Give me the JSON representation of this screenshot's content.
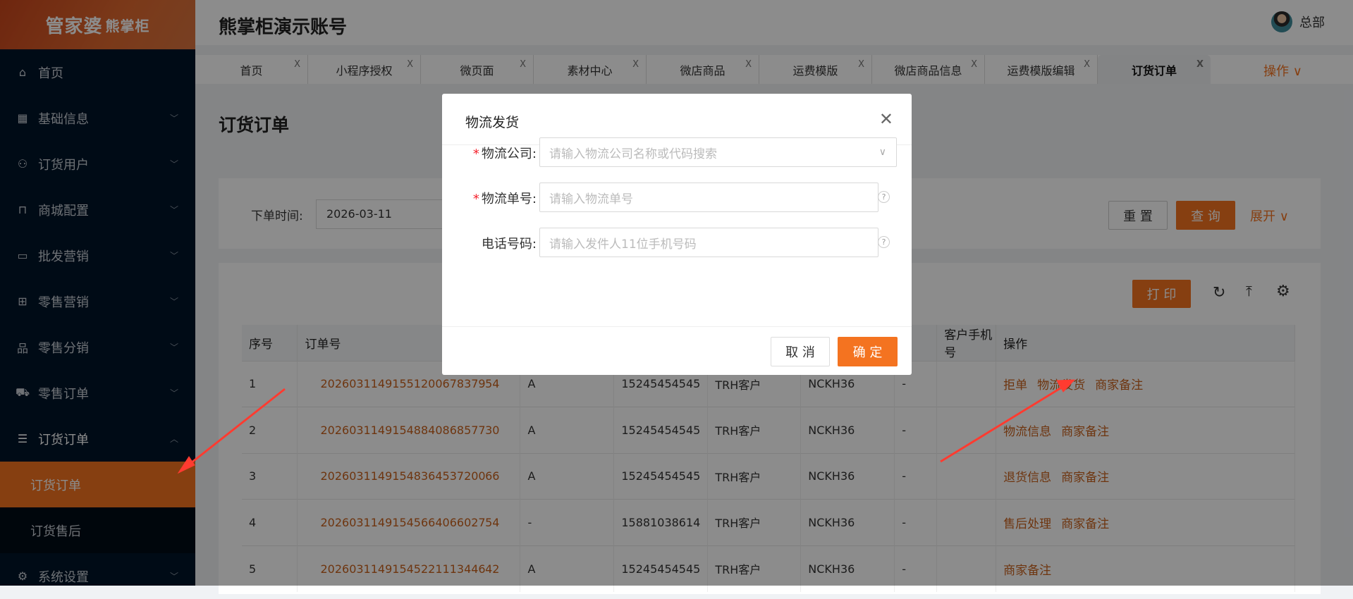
{
  "sidebar": {
    "logo": "管家婆",
    "logo_sub": "熊掌柜",
    "items": [
      {
        "label": "首页",
        "icon": "⌂"
      },
      {
        "label": "基础信息",
        "icon": "▦"
      },
      {
        "label": "订货用户",
        "icon": "⚇"
      },
      {
        "label": "商城配置",
        "icon": "⊓"
      },
      {
        "label": "批发营销",
        "icon": "▭"
      },
      {
        "label": "零售营销",
        "icon": "⊞"
      },
      {
        "label": "零售分销",
        "icon": "品"
      },
      {
        "label": "零售订单",
        "icon": "⛟"
      },
      {
        "label": "订货订单",
        "icon": "☰"
      }
    ],
    "subitems": [
      "订货订单",
      "订货售后"
    ],
    "settings": {
      "label": "系统设置",
      "icon": "⚙"
    }
  },
  "header": {
    "title": "熊掌柜演示账号",
    "user": "总部"
  },
  "tabs": [
    "首页",
    "小程序授权",
    "微页面",
    "素材中心",
    "微店商品",
    "运费模版",
    "微店商品信息",
    "运费模版编辑",
    "订货订单"
  ],
  "tab_close": "X",
  "ops_label": "操作 ∨",
  "page_title": "订货订单",
  "filter": {
    "label": "下单时间:",
    "date_start": "2026-03-11",
    "reset": "重 置",
    "query": "查 询",
    "expand": "展开 ∨"
  },
  "toolbar": {
    "print": "打 印"
  },
  "table": {
    "headers": [
      "序号",
      "订单号",
      "",
      "",
      "",
      "",
      "",
      "客户手机号",
      "操作"
    ],
    "rows": [
      {
        "no": "1",
        "order": "20260311491551200678379 54",
        "c3": "A",
        "phone": "15245454545",
        "type": "TRH客户",
        "code": "NCKH36",
        "c7": "-",
        "actions": [
          "拒单",
          "物流发货",
          "商家备注"
        ]
      },
      {
        "no": "2",
        "order": "20260311491548840868577 30",
        "c3": "A",
        "phone": "15245454545",
        "type": "TRH客户",
        "code": "NCKH36",
        "c7": "-",
        "actions": [
          "物流信息",
          "商家备注"
        ]
      },
      {
        "no": "3",
        "order": "20260311491548364537200 66",
        "c3": "A",
        "phone": "15245454545",
        "type": "TRH客户",
        "code": "NCKH36",
        "c7": "-",
        "actions": [
          "退货信息",
          "商家备注"
        ]
      },
      {
        "no": "4",
        "order": "20260311491545664066027 54",
        "c3": "-",
        "phone": "15881038614",
        "type": "TRH客户",
        "code": "NCKH36",
        "c7": "-",
        "actions": [
          "售后处理",
          "商家备注"
        ]
      },
      {
        "no": "5",
        "order": "20260311491545221113446 42",
        "c3": "A",
        "phone": "15245454545",
        "type": "TRH客户",
        "code": "NCKH36",
        "c7": "-",
        "actions": [
          "商家备注"
        ]
      }
    ]
  },
  "modal": {
    "title": "物流发货",
    "fields": [
      {
        "label": "物流公司:",
        "required": true,
        "placeholder": "请输入物流公司名称或代码搜索"
      },
      {
        "label": "物流单号:",
        "required": true,
        "placeholder": "请输入物流单号"
      },
      {
        "label": "电话号码:",
        "required": false,
        "placeholder": "请输入发件人11位手机号码"
      }
    ],
    "cancel": "取 消",
    "ok": "确 定"
  },
  "colors": {
    "accent": "#f47320",
    "sidebar": "#001529",
    "arrow": "#ff3b30"
  }
}
